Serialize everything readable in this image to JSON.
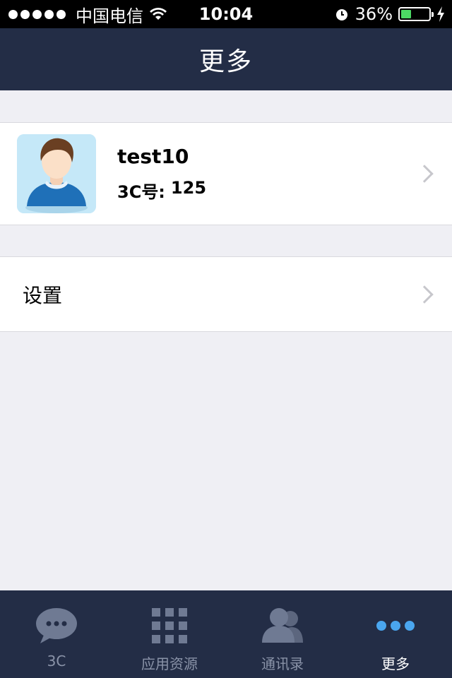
{
  "status_bar": {
    "carrier": "中国电信",
    "time": "10:04",
    "battery_percent": "36%",
    "battery_level": 0.36
  },
  "nav": {
    "title": "更多"
  },
  "profile": {
    "name": "test10",
    "id_label": "3C号:",
    "id_value": "125"
  },
  "menu": {
    "settings_label": "设置"
  },
  "tabs": [
    {
      "label": "3C",
      "icon": "chat-bubble-icon",
      "active": false
    },
    {
      "label": "应用资源",
      "icon": "grid-icon",
      "active": false
    },
    {
      "label": "通讯录",
      "icon": "contacts-icon",
      "active": false
    },
    {
      "label": "更多",
      "icon": "more-dots-icon",
      "active": true
    }
  ],
  "colors": {
    "nav_bg": "#232d46",
    "tab_inactive": "#8a93a8",
    "tab_active_icon": "#4aa6ef",
    "battery": "#4cd964"
  }
}
